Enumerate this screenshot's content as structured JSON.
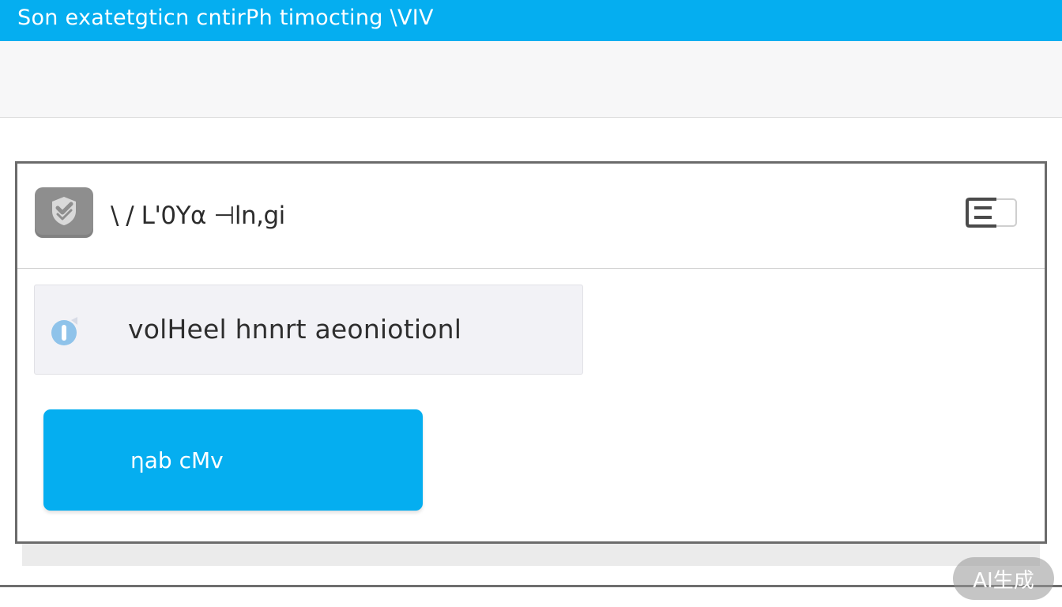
{
  "window": {
    "title": "Son exatetgticn cntirPh timocting \\VIV"
  },
  "card": {
    "header_label": "\\ / L'0Yα ⊣ln,gi",
    "icon": "shield-check-icon",
    "toggle_icon": "window-toggle-icon"
  },
  "notice": {
    "icon": "info-toggle-icon",
    "text": "volHeel hnnrt aeoniotionl"
  },
  "primary_button": {
    "label": "ηab cMv"
  },
  "watermark": {
    "text": "AI生成"
  },
  "colors": {
    "accent": "#05aef0",
    "card_border": "#6b6b6b",
    "notice_bg": "#f2f2f6",
    "icon_gray": "#8e8e8e"
  }
}
